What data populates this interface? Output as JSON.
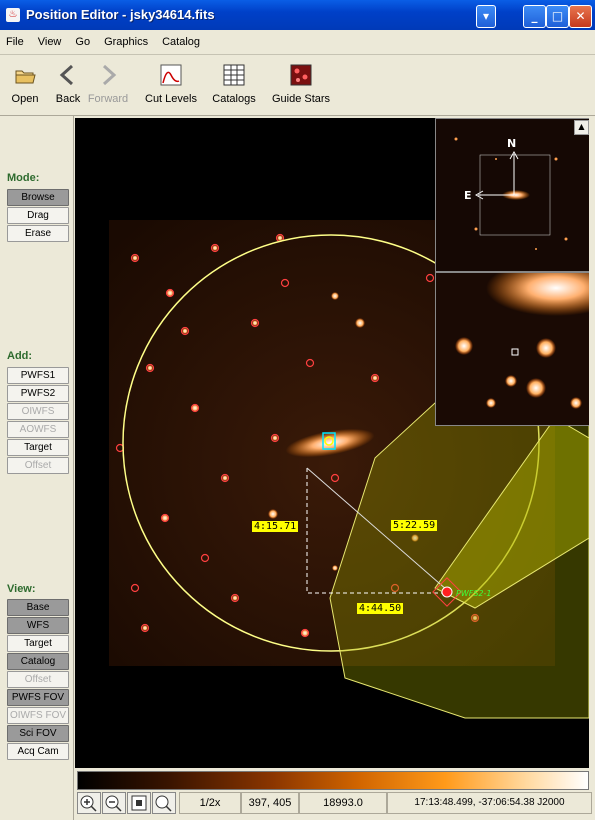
{
  "window": {
    "title": "Position Editor - jsky34614.fits"
  },
  "menu": [
    "File",
    "View",
    "Go",
    "Graphics",
    "Catalog"
  ],
  "toolbar": {
    "open": "Open",
    "back": "Back",
    "forward": "Forward",
    "cut_levels": "Cut Levels",
    "catalogs": "Catalogs",
    "guide_stars": "Guide Stars"
  },
  "mode": {
    "label": "Mode:",
    "browse": "Browse",
    "drag": "Drag",
    "erase": "Erase"
  },
  "add": {
    "label": "Add:",
    "pwfs1": "PWFS1",
    "pwfs2": "PWFS2",
    "oiwfs": "OIWFS",
    "aowfs": "AOWFS",
    "target": "Target",
    "offset": "Offset"
  },
  "view": {
    "label": "View:",
    "base": "Base",
    "wfs": "WFS",
    "target": "Target",
    "catalog": "Catalog",
    "offset": "Offset",
    "pwfs_fov": "PWFS FOV",
    "oiwfs_fov": "OIWFS FOV",
    "sci_fov": "Sci FOV",
    "acq_cam": "Acq Cam"
  },
  "image": {
    "labels": {
      "l1": "4:15.71",
      "l2": "5:22.59",
      "l3": "4:44.50",
      "guide": "PWFS2-1"
    },
    "compass": {
      "north": "N",
      "east": "E"
    }
  },
  "status": {
    "zoom": "1/2x",
    "pixel": "397, 405",
    "value": "18993.0",
    "coords": "17:13:48.499, -37:06:54.38 J2000"
  },
  "colors": {
    "accent": "#0054e3",
    "overlay": "#ffff66",
    "mode_label": "#2e6b2e"
  }
}
